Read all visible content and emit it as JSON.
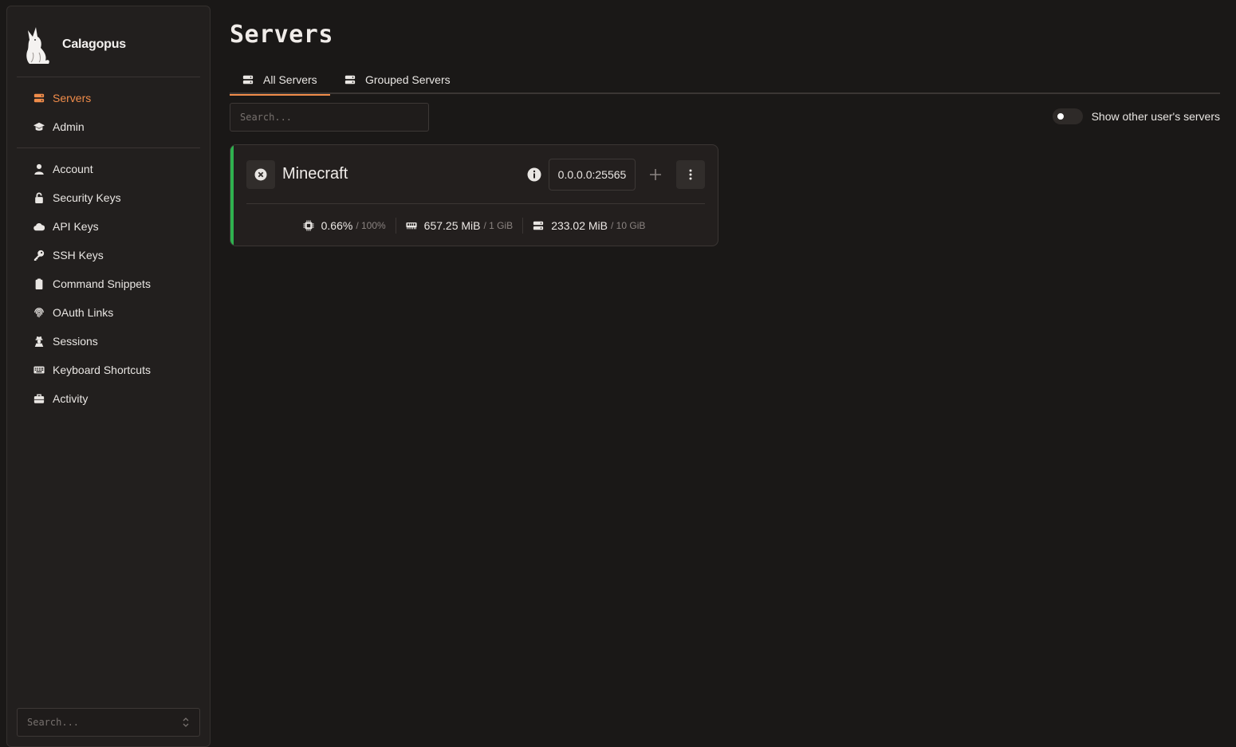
{
  "app": {
    "name": "Calagopus"
  },
  "sidebar": {
    "primary": [
      {
        "label": "Servers",
        "icon": "server-icon",
        "active": true
      },
      {
        "label": "Admin",
        "icon": "graduation-cap-icon",
        "active": false
      }
    ],
    "account": [
      {
        "label": "Account",
        "icon": "user-icon"
      },
      {
        "label": "Security Keys",
        "icon": "lock-icon"
      },
      {
        "label": "API Keys",
        "icon": "cloud-icon"
      },
      {
        "label": "SSH Keys",
        "icon": "key-icon"
      },
      {
        "label": "Command Snippets",
        "icon": "clipboard-icon"
      },
      {
        "label": "OAuth Links",
        "icon": "fingerprint-icon"
      },
      {
        "label": "Sessions",
        "icon": "user-secret-icon"
      },
      {
        "label": "Keyboard Shortcuts",
        "icon": "keyboard-icon"
      },
      {
        "label": "Activity",
        "icon": "briefcase-icon"
      }
    ],
    "search_placeholder": "Search..."
  },
  "page": {
    "title": "Servers",
    "tabs": [
      {
        "label": "All Servers",
        "active": true
      },
      {
        "label": "Grouped Servers",
        "active": false
      }
    ],
    "search_placeholder": "Search...",
    "toggle_label": "Show other user's servers",
    "toggle_on": false
  },
  "server": {
    "name": "Minecraft",
    "address": "0.0.0.0:25565",
    "status_color": "#2fb14f",
    "cpu": {
      "used": "0.66%",
      "limit": "/ 100%"
    },
    "memory": {
      "used": "657.25 MiB",
      "limit": "/ 1 GiB"
    },
    "disk": {
      "used": "233.02 MiB",
      "limit": "/ 10 GiB"
    }
  },
  "colors": {
    "accent": "#f08c4a",
    "background": "#1a1817",
    "panel": "#221f1e"
  }
}
